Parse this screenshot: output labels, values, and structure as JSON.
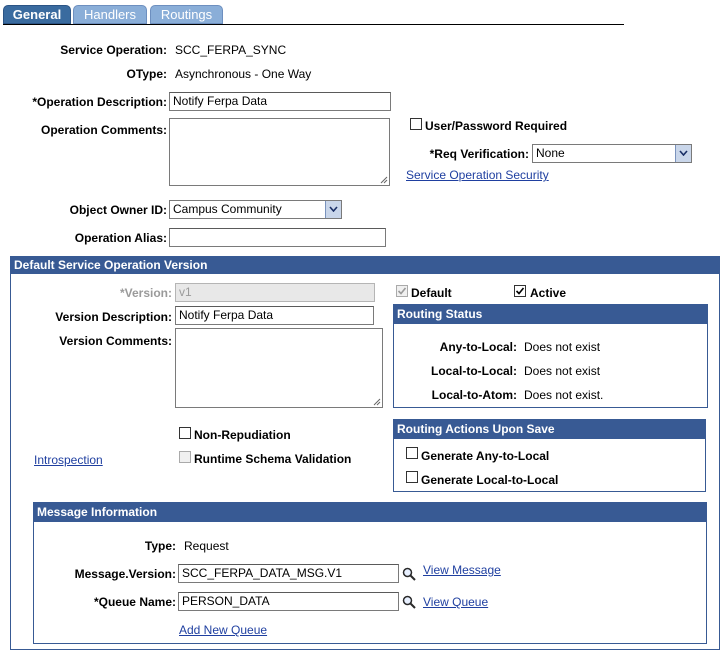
{
  "tabs": [
    {
      "label": "General",
      "active": true
    },
    {
      "label": "Handlers",
      "active": false
    },
    {
      "label": "Routings",
      "active": false
    }
  ],
  "general": {
    "service_operation_label": "Service Operation:",
    "service_operation_value": "SCC_FERPA_SYNC",
    "otype_label": "OType:",
    "otype_value": "Asynchronous - One Way",
    "operation_description_label": "*Operation Description:",
    "operation_description_value": "Notify Ferpa Data",
    "operation_comments_label": "Operation Comments:",
    "operation_comments_value": "",
    "user_password_label": "User/Password Required",
    "req_verification_label": "*Req Verification:",
    "req_verification_value": "None",
    "service_operation_security_link": "Service Operation Security",
    "object_owner_label": "Object Owner ID:",
    "object_owner_value": "Campus Community",
    "operation_alias_label": "Operation Alias:",
    "operation_alias_value": ""
  },
  "version_section": {
    "title": "Default Service Operation Version",
    "version_label": "*Version:",
    "version_value": "v1",
    "default_label": "Default",
    "active_label": "Active",
    "version_description_label": "Version Description:",
    "version_description_value": "Notify Ferpa Data",
    "version_comments_label": "Version Comments:",
    "version_comments_value": "",
    "non_repudiation_label": "Non-Repudiation",
    "runtime_schema_label": "Runtime Schema Validation",
    "introspection_link": "Introspection"
  },
  "routing_status": {
    "title": "Routing Status",
    "any_to_local_label": "Any-to-Local:",
    "any_to_local_value": "Does not exist",
    "local_to_local_label": "Local-to-Local:",
    "local_to_local_value": "Does not exist",
    "local_to_atom_label": "Local-to-Atom:",
    "local_to_atom_value": "Does not exist."
  },
  "routing_actions": {
    "title": "Routing Actions Upon Save",
    "generate_any_label": "Generate Any-to-Local",
    "generate_local_label": "Generate Local-to-Local"
  },
  "message_info": {
    "title": "Message Information",
    "type_label": "Type:",
    "type_value": "Request",
    "message_version_label": "Message.Version:",
    "message_version_value": "SCC_FERPA_DATA_MSG.V1",
    "view_message_link": "View Message",
    "queue_name_label": "*Queue Name:",
    "queue_name_value": "PERSON_DATA",
    "view_queue_link": "View Queue",
    "add_new_queue_link": "Add New Queue"
  },
  "colors": {
    "tab_active": "#3a6b9f",
    "tab_inactive": "#8aaed8",
    "section_header": "#385a94",
    "link": "#1f3fa0"
  }
}
